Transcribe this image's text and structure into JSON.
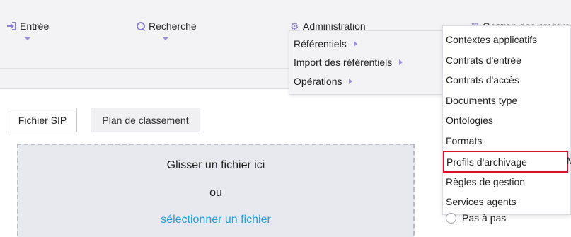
{
  "nav": {
    "entree": "Entrée",
    "recherche": "Recherche",
    "administration": "Administration",
    "gestion": "Gestion des archives"
  },
  "admin_menu": {
    "items": [
      "Référentiels",
      "Import des référentiels",
      "Opérations"
    ]
  },
  "referentiels_submenu": {
    "items": [
      "Contextes applicatifs",
      "Contrats d'entrée",
      "Contrats d'accès",
      "Documents type",
      "Ontologies",
      "Formats",
      "Profils d'archivage",
      "Règles de gestion",
      "Services agents"
    ],
    "highlighted": "Profils d'archivage",
    "highlight_color": "#d9112a"
  },
  "tabs": {
    "active": "Fichier SIP",
    "inactive": "Plan de classement"
  },
  "dropzone": {
    "line1": "Glisser un fichier ici",
    "line2": "ou",
    "link": "sélectionner un fichier"
  },
  "options": {
    "pas_a_pas": "Pas à pas",
    "side_letter": "M"
  },
  "icons": {
    "entree": "login-icon",
    "recherche": "search-icon",
    "administration": "gears-icon",
    "gestion": "chart-icon"
  },
  "colors": {
    "accent": "#8b7fd0",
    "link": "#2a9ad6"
  }
}
